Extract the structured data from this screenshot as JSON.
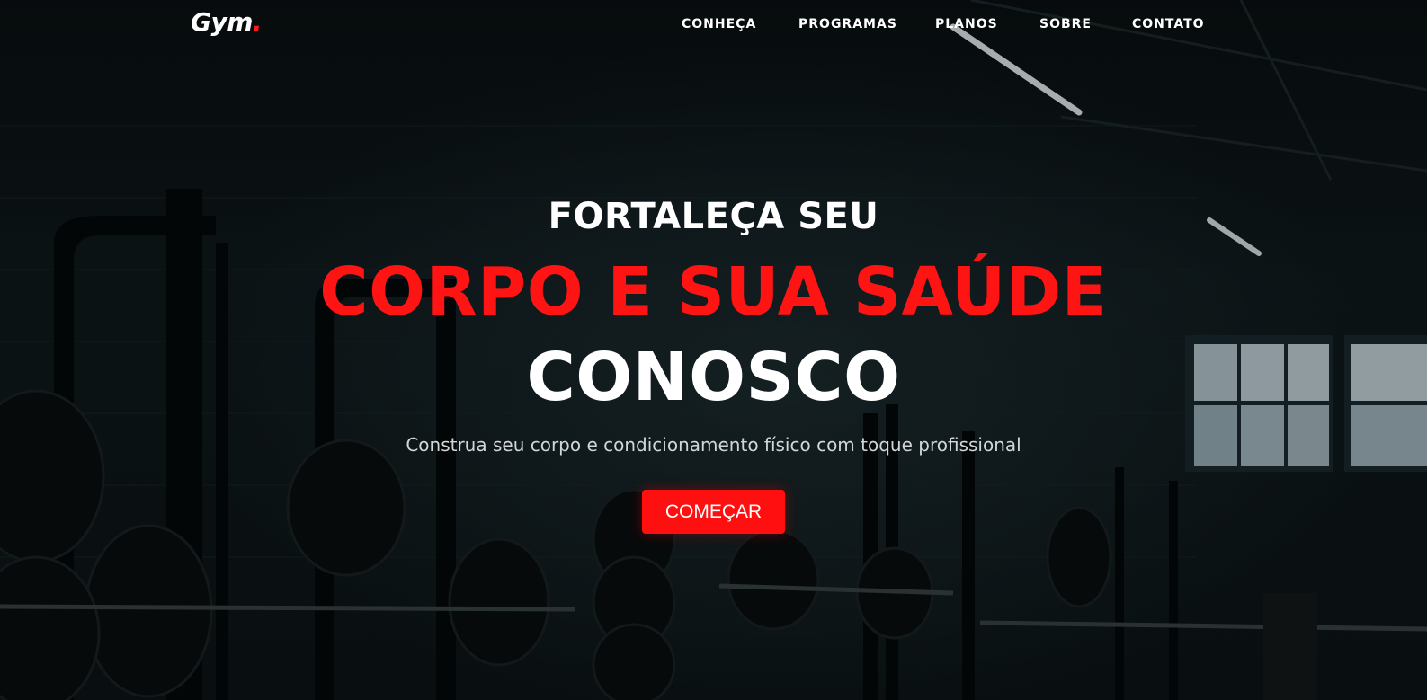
{
  "header": {
    "logo_text": "Gym",
    "logo_dot": ".",
    "nav": [
      {
        "label": "CONHEÇA"
      },
      {
        "label": "PROGRAMAS"
      },
      {
        "label": "PLANOS"
      },
      {
        "label": "SOBRE"
      },
      {
        "label": "CONTATO"
      }
    ]
  },
  "hero": {
    "kicker": "FORTALEÇA SEU",
    "headline_accent": "CORPO E SUA SAÚDE",
    "headline_main": "CONOSCO",
    "subtitle": "Construa seu corpo e condicionamento físico com toque profissional",
    "cta_label": "COMEÇAR"
  },
  "colors": {
    "accent": "#ff1414",
    "background": "#0b1417",
    "text": "#ffffff"
  }
}
